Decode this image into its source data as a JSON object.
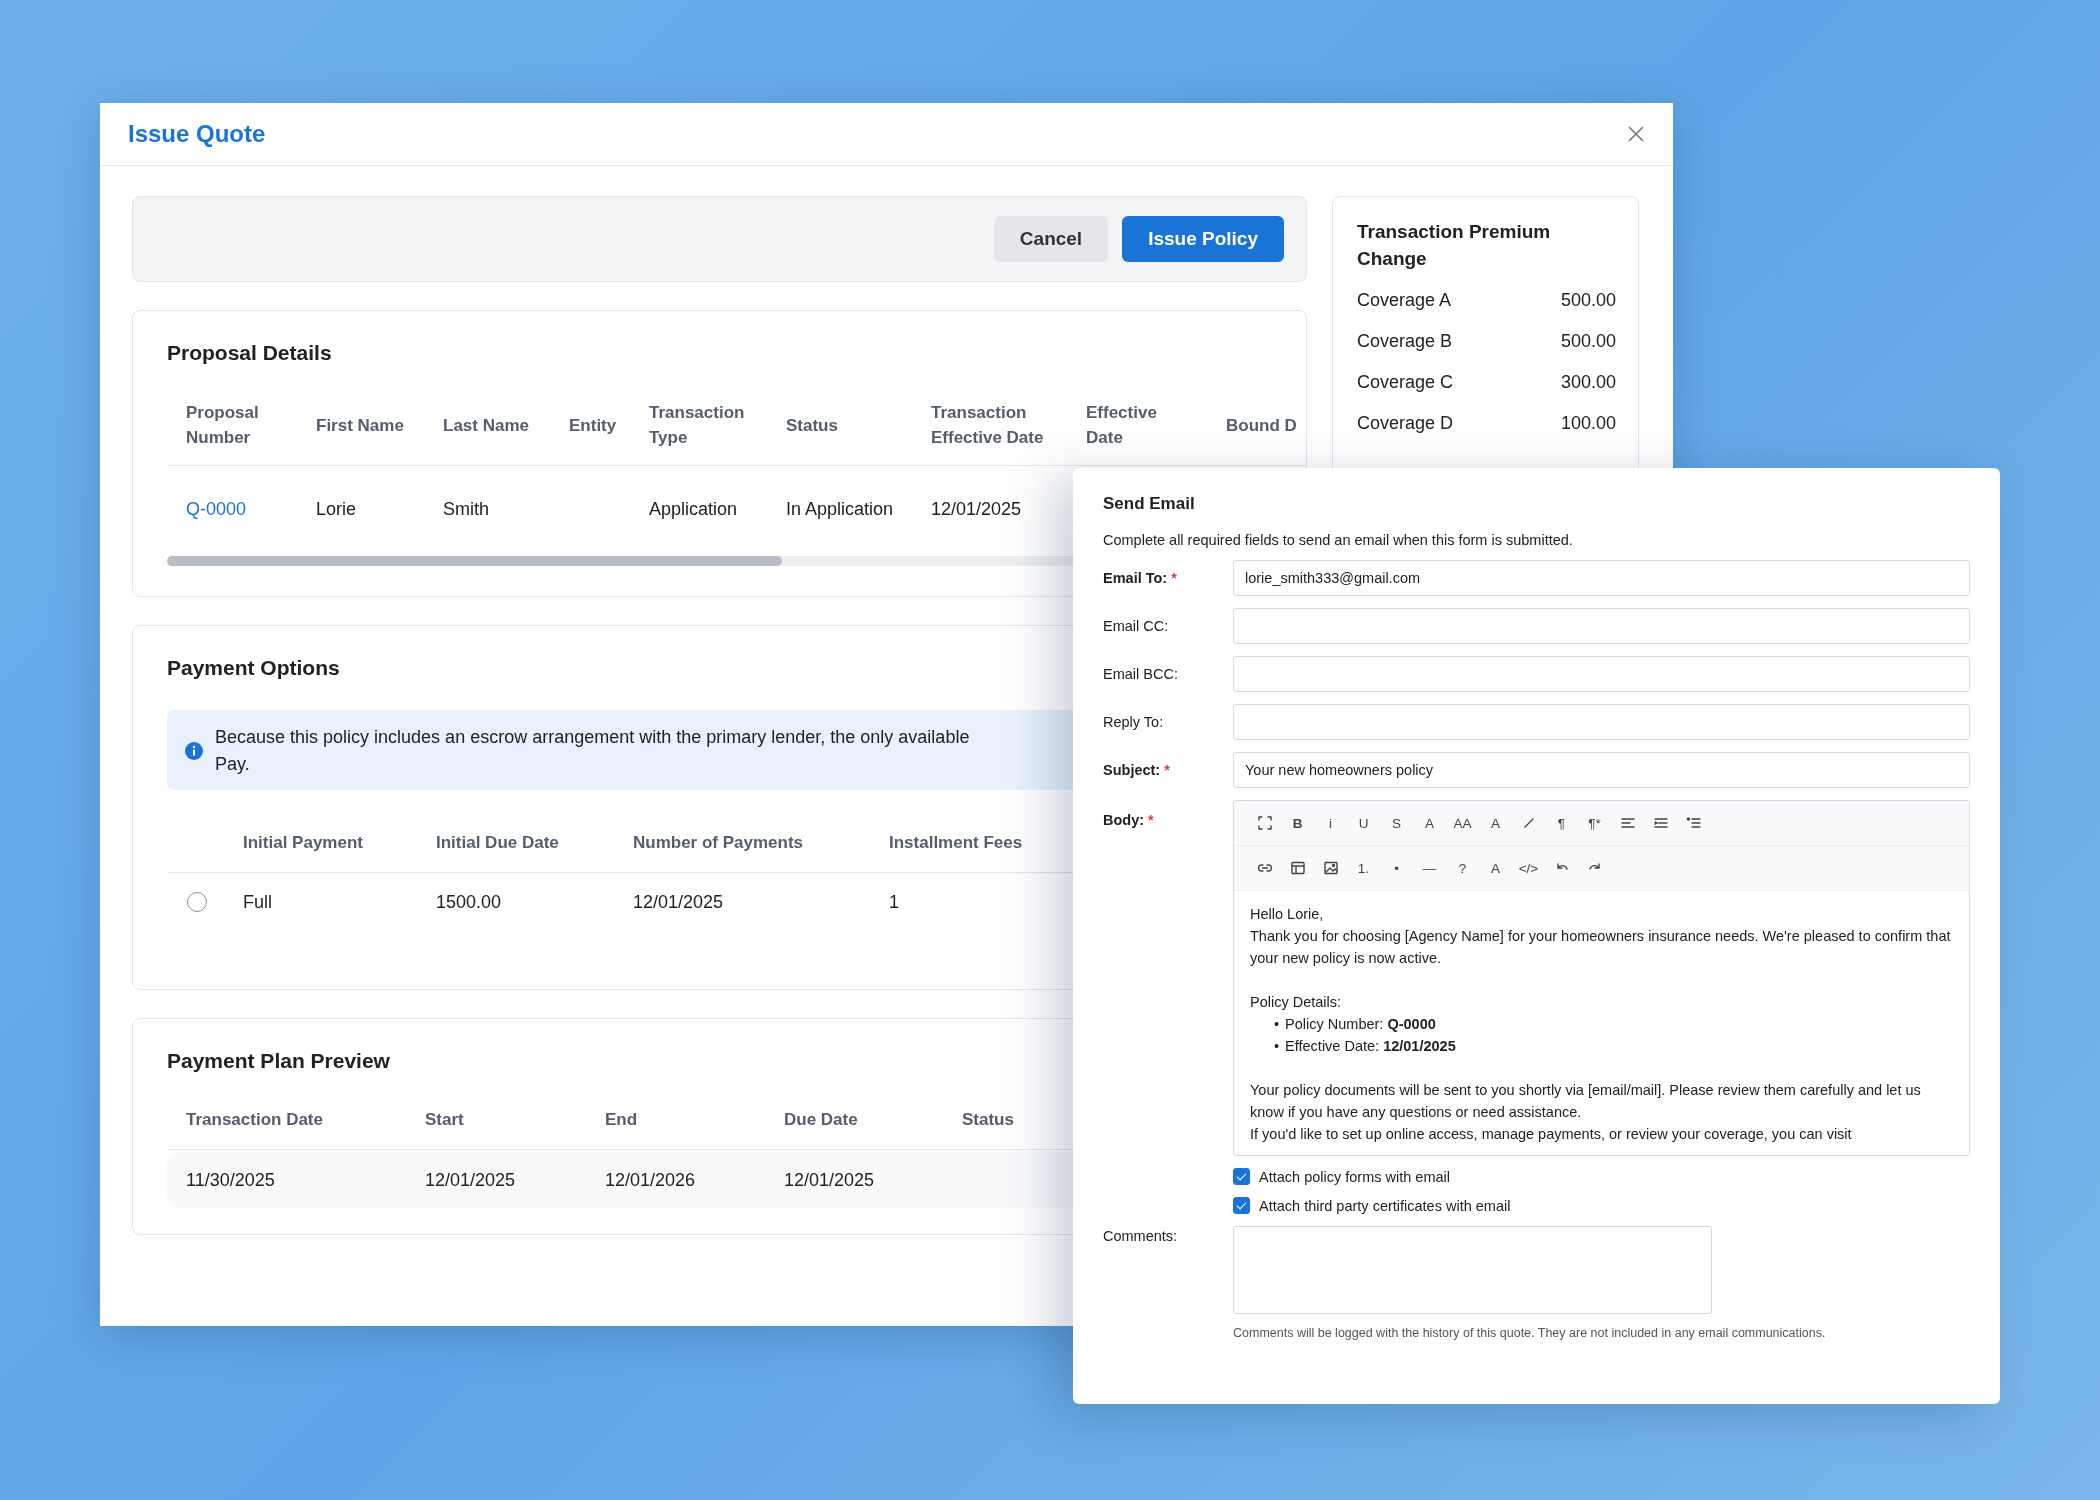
{
  "window": {
    "title": "Issue Quote"
  },
  "actions": [
    {
      "label": "Cancel",
      "kind": "secondary"
    },
    {
      "label": "Issue Policy",
      "kind": "primary"
    }
  ],
  "proposal_details": {
    "title": "Proposal Details",
    "columns": [
      "Proposal Number",
      "First Name",
      "Last Name",
      "Entity",
      "Transaction Type",
      "Status",
      "Transaction Effective Date",
      "Effective Date",
      "Bound D"
    ],
    "rows": [
      {
        "cells": [
          "Q-0000",
          "Lorie",
          "Smith",
          "",
          "Application",
          "In Application",
          "12/01/2025"
        ]
      }
    ]
  },
  "payment_options": {
    "title": "Payment Options",
    "notice": [
      "Because this policy includes an escrow arrangement with the primary lender, the only available",
      "Pay."
    ],
    "columns": [
      "Initial Payment",
      "Initial Due Date",
      "Number of Payments",
      "Installment Fees"
    ],
    "rows": [
      {
        "selected": false,
        "cells": [
          "Full",
          "1500.00",
          "12/01/2025",
          "1"
        ]
      }
    ]
  },
  "payment_plan_preview": {
    "title": "Payment Plan Preview",
    "columns": [
      "Transaction Date",
      "Start",
      "End",
      "Due Date",
      "Status"
    ],
    "rows": [
      {
        "cells": [
          "11/30/2025",
          "12/01/2025",
          "12/01/2026",
          "12/01/2025",
          ""
        ]
      }
    ]
  },
  "premium_change": {
    "title": "Transaction Premium Change",
    "rows": [
      {
        "name": "Coverage A",
        "amount": "500.00"
      },
      {
        "name": "Coverage B",
        "amount": "500.00"
      },
      {
        "name": "Coverage C",
        "amount": "300.00"
      },
      {
        "name": "Coverage D",
        "amount": "100.00"
      }
    ]
  },
  "send_email": {
    "title": "Send Email",
    "description": "Complete all required fields to send an email when this form is submitted.",
    "fields": [
      {
        "label": "Email To:",
        "required": true,
        "marker": "*",
        "value": "lorie_smith333@gmail.com"
      },
      {
        "label": "Email CC:",
        "required": false
      },
      {
        "label": "Email BCC:",
        "required": false
      },
      {
        "label": "Reply To:",
        "required": false
      },
      {
        "label": "Subject:",
        "required": true,
        "marker": "*",
        "value": "Your new homeowners policy"
      }
    ],
    "body": {
      "label": "Body:",
      "required": true,
      "marker": "*",
      "toolbar_rows": [
        [
          {
            "kind": "fullscreen"
          },
          {
            "kind": "bold",
            "label": "B"
          },
          {
            "kind": "text",
            "label": "i"
          },
          {
            "kind": "text",
            "label": "U"
          },
          {
            "kind": "text",
            "label": "S"
          },
          {
            "kind": "text",
            "label": "A"
          },
          {
            "kind": "text",
            "label": "AA"
          },
          {
            "kind": "text",
            "label": "A"
          },
          {
            "kind": "pen"
          },
          {
            "kind": "text",
            "label": "¶"
          },
          {
            "kind": "text",
            "label": "¶*"
          },
          {
            "kind": "align"
          },
          {
            "kind": "indent"
          },
          {
            "kind": "outdent"
          }
        ],
        [
          {
            "kind": "link"
          },
          {
            "kind": "table"
          },
          {
            "kind": "image"
          },
          {
            "kind": "text",
            "label": "1."
          },
          {
            "kind": "text",
            "label": "•"
          },
          {
            "kind": "text",
            "label": "—"
          },
          {
            "kind": "text",
            "label": "?"
          },
          {
            "kind": "text",
            "label": "A"
          },
          {
            "kind": "text",
            "label": "</>"
          },
          {
            "kind": "undo"
          },
          {
            "kind": "redo"
          }
        ]
      ],
      "blocks": [
        {
          "lines": [
            "Hello Lorie,",
            "Thank you for choosing [Agency Name] for your homeowners insurance needs. We're pleased to confirm that your new policy is now active."
          ]
        },
        {
          "lines": [
            "Policy Details:"
          ],
          "bullets": [
            {
              "marker": "•",
              "text": "Policy Number: **Q-0000**"
            },
            {
              "marker": "•",
              "text": "Effective Date: **12/01/2025**"
            }
          ]
        },
        {
          "lines": [
            "Your policy documents will be sent to you shortly via [email/mail]. Please review them carefully and let us know if you have any questions or need assistance.",
            "If you'd like to set up online access, manage payments, or review your coverage, you can visit"
          ]
        }
      ]
    },
    "attachments": [
      {
        "label": "Attach policy forms with email",
        "checked": true
      },
      {
        "label": "Attach third party certificates with email",
        "checked": true
      }
    ],
    "comments": {
      "label": "Comments:",
      "hint": "Comments will be logged with the history of this quote. They are not included in any email communications."
    }
  }
}
